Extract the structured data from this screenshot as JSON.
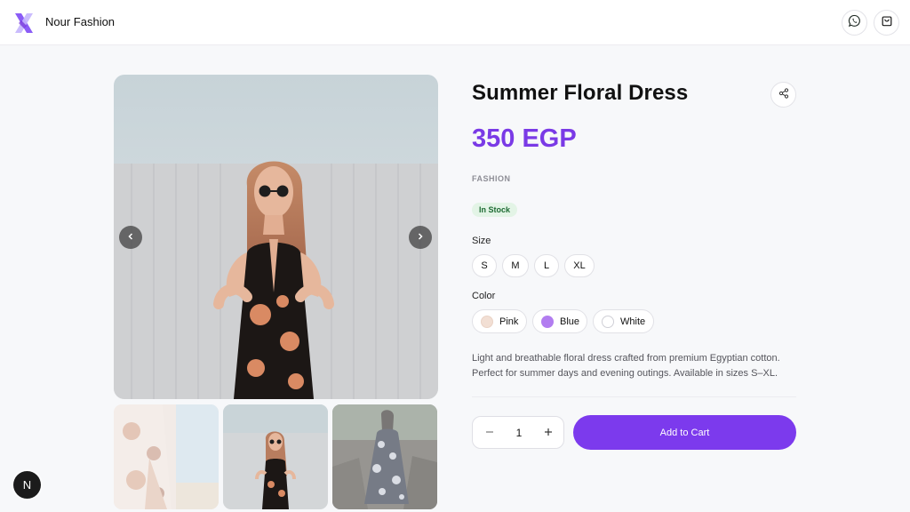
{
  "header": {
    "brand": "Nour Fashion",
    "logo_icon": "x-logo-icon",
    "whatsapp_icon": "whatsapp-icon",
    "cart_icon": "shopping-bag-icon"
  },
  "gallery": {
    "main_image": "woman-in-floral-dress-sunglasses",
    "prev_icon": "chevron-left-icon",
    "next_icon": "chevron-right-icon",
    "thumbnails": [
      "floral-dress-detail",
      "woman-in-floral-dress-sunglasses",
      "dark-floral-dress-outdoors"
    ],
    "active_thumbnail": 1
  },
  "product": {
    "title": "Summer Floral Dress",
    "price": "350 EGP",
    "category": "FASHION",
    "stock": "In Stock",
    "size_label": "Size",
    "sizes": [
      "S",
      "M",
      "L",
      "XL"
    ],
    "color_label": "Color",
    "colors": [
      {
        "name": "Pink",
        "hex": "#f2dfd4"
      },
      {
        "name": "Blue",
        "hex": "#b27df0"
      },
      {
        "name": "White",
        "hex": "#ffffff"
      }
    ],
    "description": "Light and breathable floral dress crafted from premium Egyptian cotton. Perfect for summer days and evening outings. Available in sizes S–XL.",
    "quantity": "1",
    "add_to_cart": "Add to Cart",
    "share_icon": "share-icon"
  },
  "dev_badge": "N",
  "theme": {
    "accent": "#7c3aed",
    "price_color": "#7a3ae6",
    "stock_bg": "#e3f4e6",
    "stock_text": "#1d6b33"
  }
}
